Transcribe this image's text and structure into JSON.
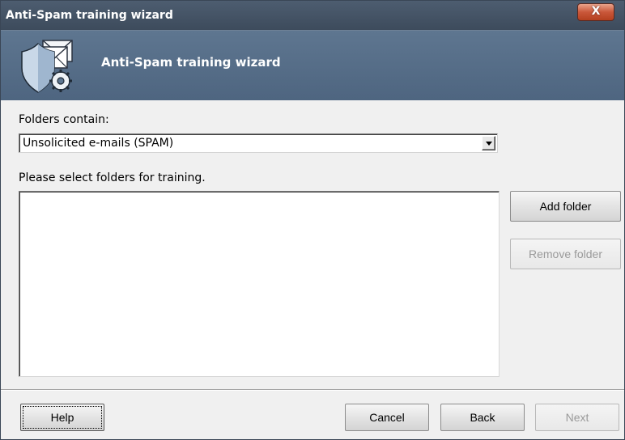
{
  "window": {
    "title": "Anti-Spam training wizard",
    "close_glyph": "X"
  },
  "header": {
    "title": "Anti-Spam training wizard",
    "icon": "shield-envelope-gear-icon"
  },
  "form": {
    "folders_label": "Folders contain:",
    "folders_select_value": "Unsolicited e-mails (SPAM)",
    "instruction": "Please select folders for training.",
    "folders_list": []
  },
  "side_buttons": {
    "add_folder": "Add folder",
    "remove_folder": "Remove folder"
  },
  "footer": {
    "help": "Help",
    "cancel": "Cancel",
    "back": "Back",
    "next": "Next"
  },
  "colors": {
    "titlebar": "#3d4b5c",
    "header": "#5e7690",
    "close_button": "#c9573a",
    "window_bg": "#f0f0f0"
  }
}
